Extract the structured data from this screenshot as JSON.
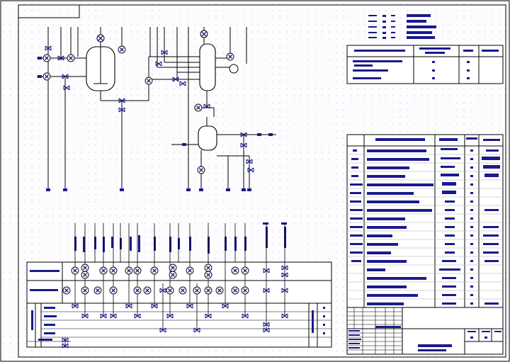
{
  "drawing": {
    "border_color": "#000000",
    "line_color": "#000000",
    "symbol_color": "#1a1a8c",
    "fill_text_color": "#1a1a8c"
  }
}
